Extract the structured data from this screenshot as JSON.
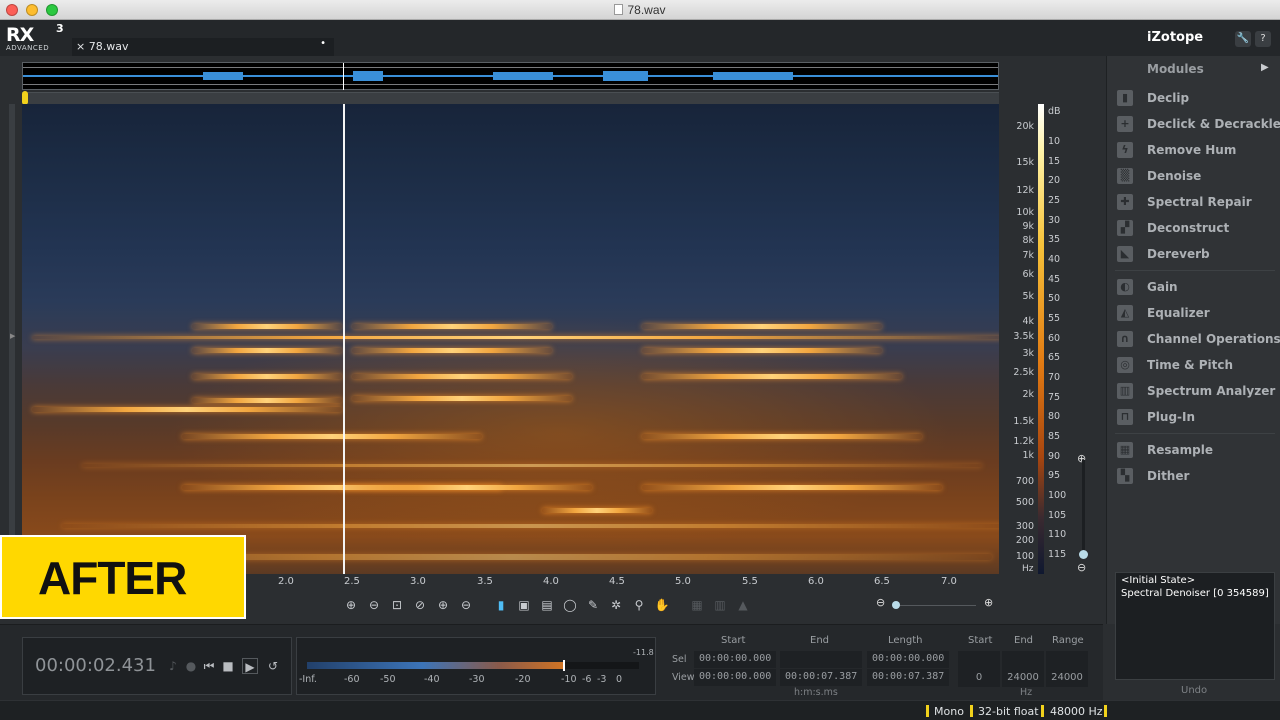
{
  "window": {
    "title": "78.wav"
  },
  "app": {
    "logo_main": "RX",
    "logo_sup": "3",
    "logo_sub": "ADVANCED",
    "brand": "iZotope",
    "tab_close": "×",
    "tab_name": "78.wav",
    "tab_modified": "•"
  },
  "header_buttons": {
    "settings": "🔧",
    "help": "?"
  },
  "spectrogram": {
    "freq_labels": [
      "20k",
      "15k",
      "12k",
      "10k",
      "9k",
      "8k",
      "7k",
      "6k",
      "5k",
      "4k",
      "3.5k",
      "3k",
      "2.5k",
      "2k",
      "1.5k",
      "1.2k",
      "1k",
      "700",
      "500",
      "300",
      "200",
      "100"
    ],
    "freq_unit": "Hz",
    "db_unit": "dB",
    "db_labels": [
      "10",
      "15",
      "20",
      "25",
      "30",
      "35",
      "40",
      "45",
      "50",
      "55",
      "60",
      "65",
      "70",
      "75",
      "80",
      "85",
      "90",
      "95",
      "100",
      "105",
      "110",
      "115"
    ],
    "time_labels": [
      "2.0",
      "2.5",
      "3.0",
      "3.5",
      "4.0",
      "4.5",
      "5.0",
      "5.5",
      "6.0",
      "6.5",
      "7.0"
    ],
    "colors": {
      "low": "#17243a",
      "mid": "#e27b13",
      "high": "#ffd27a"
    }
  },
  "badge": {
    "text": "AFTER",
    "color": "#ffd800"
  },
  "modules": {
    "header": "Modules",
    "arrow": "▶",
    "group1": [
      {
        "label": "Declip",
        "icon": "declip-icon"
      },
      {
        "label": "Declick & Decrackle",
        "icon": "declick-icon"
      },
      {
        "label": "Remove Hum",
        "icon": "hum-icon"
      },
      {
        "label": "Denoise",
        "icon": "denoise-icon"
      },
      {
        "label": "Spectral Repair",
        "icon": "spectral-repair-icon"
      },
      {
        "label": "Deconstruct",
        "icon": "deconstruct-icon"
      },
      {
        "label": "Dereverb",
        "icon": "dereverb-icon"
      }
    ],
    "group2": [
      {
        "label": "Gain",
        "icon": "gain-icon"
      },
      {
        "label": "Equalizer",
        "icon": "equalizer-icon"
      },
      {
        "label": "Channel Operations",
        "icon": "headphones-icon"
      },
      {
        "label": "Time & Pitch",
        "icon": "time-pitch-icon"
      },
      {
        "label": "Spectrum Analyzer",
        "icon": "spectrum-icon"
      },
      {
        "label": "Plug-In",
        "icon": "plugin-icon"
      }
    ],
    "group3": [
      {
        "label": "Resample",
        "icon": "resample-icon"
      },
      {
        "label": "Dither",
        "icon": "dither-icon"
      }
    ]
  },
  "history": {
    "items": [
      "<Initial State>",
      "Spectral Denoiser [0 354589]"
    ],
    "label": "Undo"
  },
  "transport": {
    "timecode": "00:00:02.431",
    "peak": "-11.8",
    "meter_labels": [
      "-Inf.",
      "-60",
      "-50",
      "-40",
      "-30",
      "-20",
      "-10",
      "-6",
      "-3",
      "0"
    ],
    "meter_level": 0.77
  },
  "selection": {
    "headers": {
      "start": "Start",
      "end": "End",
      "length": "Length"
    },
    "row_sel": "Sel",
    "row_view": "View",
    "sel_start": "00:00:00.000",
    "sel_end": "",
    "sel_length": "00:00:00.000",
    "view_start": "00:00:00.000",
    "view_end": "00:00:07.387",
    "view_length": "00:00:07.387",
    "unit": "h:m:s.ms"
  },
  "freq_range": {
    "headers": {
      "start": "Start",
      "end": "End",
      "range": "Range"
    },
    "start": "0",
    "end": "24000",
    "range": "24000",
    "unit": "Hz"
  },
  "status": {
    "channels": "Mono",
    "bit_depth": "32-bit float",
    "sample_rate": "48000 Hz"
  }
}
